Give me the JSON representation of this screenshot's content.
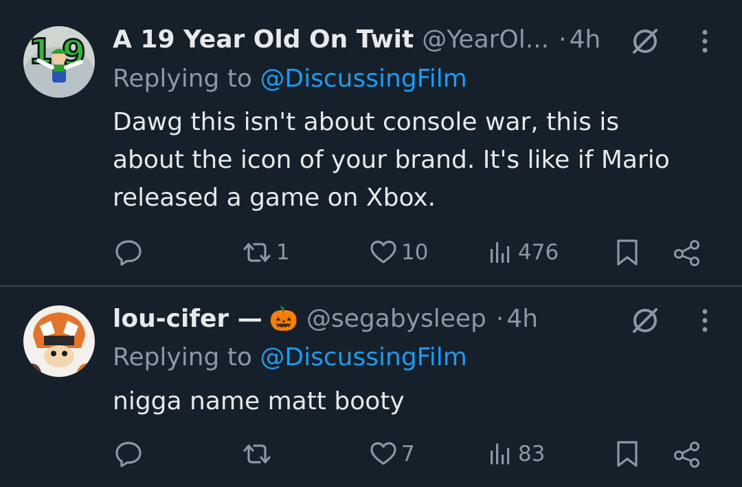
{
  "tweets": [
    {
      "display_name": "A 19 Year Old On Twit",
      "emoji": "",
      "handle": "@YearOl...",
      "dot": "·",
      "time": "4h",
      "replying_prefix": "Replying to ",
      "replying_mention": "@DiscussingFilm",
      "text": "Dawg this isn't about console war, this is\nabout the icon of your brand. It's like if Mario\nreleased a game on Xbox.",
      "counts": {
        "replies": "",
        "reposts": "1",
        "likes": "10",
        "views": "476"
      }
    },
    {
      "display_name": "lou-cifer —",
      "emoji": "🎃",
      "handle": "@segabysleep",
      "dot": "·",
      "time": "4h",
      "replying_prefix": "Replying to ",
      "replying_mention": "@DiscussingFilm",
      "text": "nigga name matt booty",
      "counts": {
        "replies": "",
        "reposts": "",
        "likes": "7",
        "views": "83"
      }
    }
  ],
  "icons": {
    "avatar_1": "avatar-19-green-character",
    "avatar_2": "avatar-orange-helmet-character",
    "nav": "grok-slash-circle-icon",
    "more": "more-vertical-dots-icon",
    "reply": "reply-bubble-icon",
    "repost": "repost-arrows-icon",
    "like": "heart-icon",
    "views": "views-bars-icon",
    "bookmark": "bookmark-icon",
    "share": "share-nodes-icon"
  },
  "colors": {
    "background": "#15202b",
    "text": "#e7e9ea",
    "secondary": "#8b98a5",
    "link": "#1d9bf0",
    "divider": "#38444d"
  }
}
